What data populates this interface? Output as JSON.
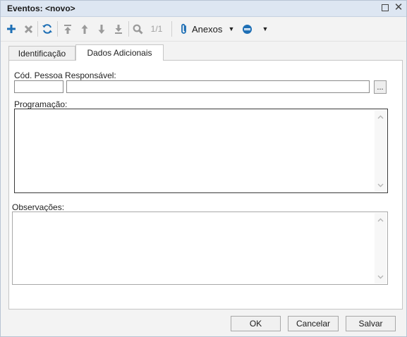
{
  "window": {
    "title": "Eventos: <novo>"
  },
  "toolbar": {
    "pager": "1/1",
    "anexos_label": "Anexos",
    "icons": [
      "add-icon",
      "delete-icon",
      "refresh-icon",
      "first-record-icon",
      "previous-record-icon",
      "next-record-icon",
      "last-record-icon",
      "search-icon",
      "paperclip-icon",
      "status-icon"
    ],
    "colors": {
      "add": "#1e6fb5",
      "disabled": "#9a9a9a",
      "refresh": "#1e6fb5",
      "paperclip": "#1e6fb5",
      "status_blue": "#1e6fb5"
    }
  },
  "tabs": [
    {
      "label": "Identificação",
      "active": false
    },
    {
      "label": "Dados Adicionais",
      "active": true
    }
  ],
  "form": {
    "cod_pessoa_label": "Cód. Pessoa Responsável:",
    "cod_pessoa_value": "",
    "nome_pessoa_value": "",
    "ellipsis_label": "...",
    "programacao_label": "Programação:",
    "programacao_value": "",
    "observacoes_label": "Observações:",
    "observacoes_value": ""
  },
  "footer": {
    "ok_label": "OK",
    "cancel_label": "Cancelar",
    "save_label": "Salvar"
  }
}
